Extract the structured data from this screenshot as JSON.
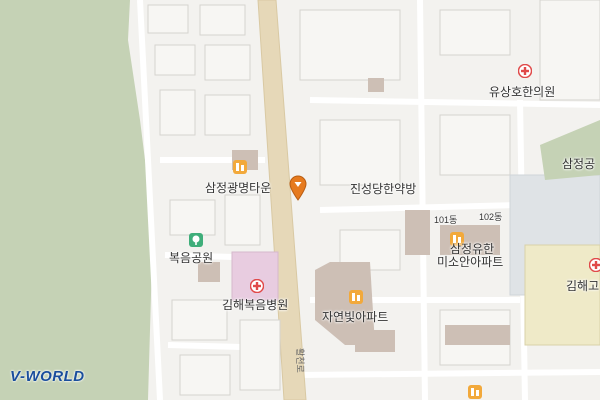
{
  "labels": {
    "samjeong_town": "삼정광명타운",
    "jinseong_pharmacy": "진성당한약방",
    "yusang_clinic": "유상호한의원",
    "bokeum_park": "복음공원",
    "gimhae_hospital": "김해복음병원",
    "jayeon_apt": "자연빛아파트",
    "misoan_apt_line1": "삼정유한",
    "misoan_apt_line2": "미소안아파트",
    "bldg_101": "101동",
    "bldg_102": "102동",
    "samjeong_right": "삼정공",
    "gimhae_right": "김해고",
    "road_name": "활천로"
  },
  "logo": "V-WORLD",
  "icons": {
    "apartment": "apartment-icon",
    "hospital": "hospital-icon",
    "park": "park-icon",
    "location": "location-pin-icon"
  },
  "colors": {
    "background": "#f3f2ef",
    "green_area": "#c5d2b5",
    "main_road": "#e6d8b8",
    "hospital_building": "#e8cce0",
    "building_dark": "#cdbfb5",
    "accent_red": "#e04a4a",
    "pin_orange": "#e67a1e"
  }
}
